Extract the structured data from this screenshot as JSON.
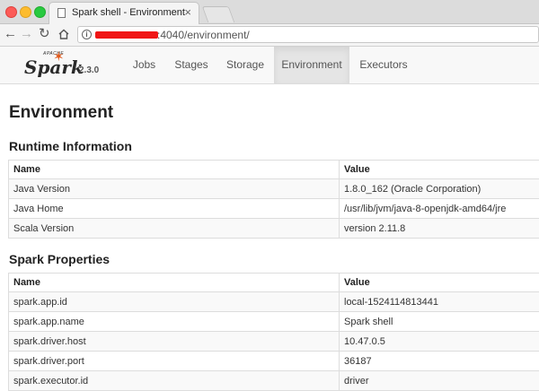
{
  "browser": {
    "tab_title": "Spark shell - Environment",
    "tab_close": "×",
    "url_suffix": ":4040/environment/"
  },
  "nav": {
    "brand_apache": "APACHE",
    "brand_name": "Spark",
    "version": "2.3.0",
    "tabs": [
      "Jobs",
      "Stages",
      "Storage",
      "Environment",
      "Executors"
    ],
    "active_tab": "Environment"
  },
  "page": {
    "title": "Environment"
  },
  "runtime": {
    "title": "Runtime Information",
    "headers": [
      "Name",
      "Value"
    ],
    "rows": [
      [
        "Java Version",
        "1.8.0_162 (Oracle Corporation)"
      ],
      [
        "Java Home",
        "/usr/lib/jvm/java-8-openjdk-amd64/jre"
      ],
      [
        "Scala Version",
        "version 2.11.8"
      ]
    ]
  },
  "spark_properties": {
    "title": "Spark Properties",
    "headers": [
      "Name",
      "Value"
    ],
    "rows": [
      [
        "spark.app.id",
        "local-1524114813441"
      ],
      [
        "spark.app.name",
        "Spark shell"
      ],
      [
        "spark.driver.host",
        "10.47.0.5"
      ],
      [
        "spark.driver.port",
        "36187"
      ],
      [
        "spark.executor.id",
        "driver"
      ]
    ]
  },
  "colors": {
    "spark_orange": "#e25a1c",
    "redaction_red": "#f01616"
  }
}
